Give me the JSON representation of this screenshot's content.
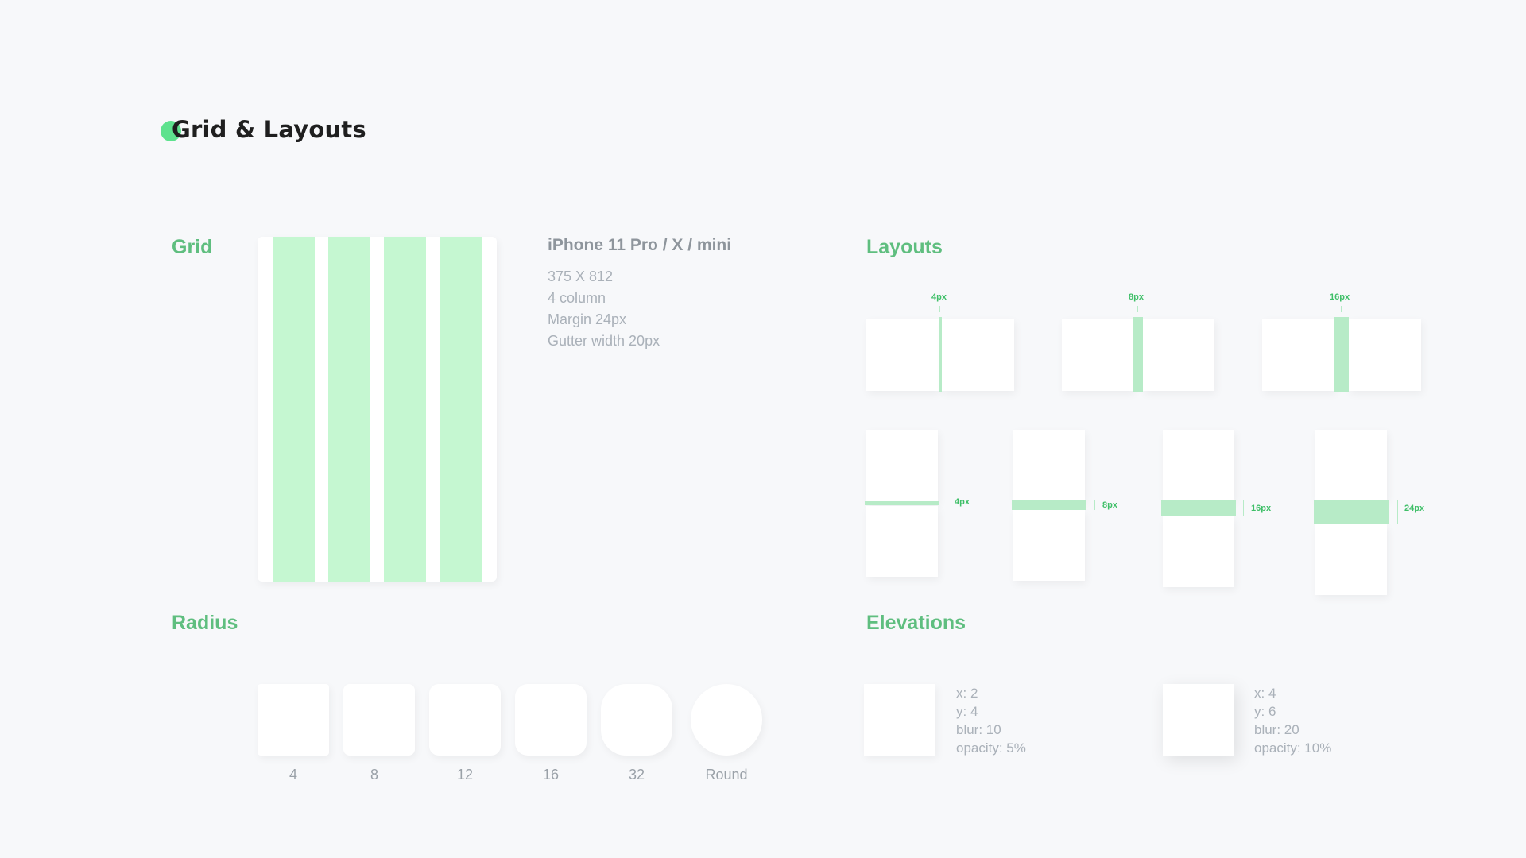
{
  "title": "Grid & Layouts",
  "sections": {
    "grid": "Grid",
    "layouts": "Layouts",
    "radius": "Radius",
    "elevations": "Elevations"
  },
  "grid_info": {
    "device": "iPhone 11 Pro / X / mini",
    "lines": [
      "375 X 812",
      "4 column",
      "Margin 24px",
      "Gutter width 20px"
    ],
    "columns": 4
  },
  "layouts": {
    "horizontal_gaps": [
      "4px",
      "8px",
      "16px"
    ],
    "vertical_gaps": [
      "4px",
      "8px",
      "16px",
      "24px"
    ]
  },
  "radius": {
    "labels": [
      "4",
      "8",
      "12",
      "16",
      "32",
      "Round"
    ]
  },
  "elevations": [
    {
      "x": "x: 2",
      "y": "y: 4",
      "blur": "blur: 10",
      "opacity": "opacity: 5%"
    },
    {
      "x": "x: 4",
      "y": "y: 6",
      "blur": "blur: 20",
      "opacity": "opacity: 10%"
    }
  ],
  "colors": {
    "accent": "#5ee28e",
    "section_title": "#5fbe7f",
    "column_fill": "#c5f7d1",
    "background": "#f7f8fa"
  }
}
